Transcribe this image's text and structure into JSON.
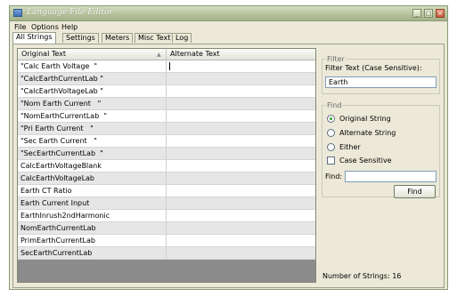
{
  "window": {
    "title": "Language File Editor",
    "controls": {
      "minimize": "_",
      "maximize": "□",
      "close": "×"
    }
  },
  "menu": [
    "File",
    "Options",
    "Help"
  ],
  "tabs": [
    {
      "label": "All Strings",
      "active": true
    },
    {
      "label": "Settings",
      "active": false
    },
    {
      "label": "Meters",
      "active": false
    },
    {
      "label": "Misc Text",
      "active": false
    },
    {
      "label": "Log",
      "active": false
    }
  ],
  "grid": {
    "columns": [
      "Original Text",
      "Alternate Text"
    ],
    "sort_indicator": "▲",
    "rows": [
      {
        "original": "\"Calc Earth Voltage  \"",
        "alternate": ""
      },
      {
        "original": "\"CalcEarthCurrentLab \"",
        "alternate": ""
      },
      {
        "original": "\"CalcEarthVoltageLab \"",
        "alternate": ""
      },
      {
        "original": "\"Nom Earth Current   \"",
        "alternate": ""
      },
      {
        "original": "\"NomEarthCurrentLab  \"",
        "alternate": ""
      },
      {
        "original": "\"Pri Earth Current   \"",
        "alternate": ""
      },
      {
        "original": "\"Sec Earth Current   \"",
        "alternate": ""
      },
      {
        "original": "\"SecEarthCurrentLab  \"",
        "alternate": ""
      },
      {
        "original": "CalcEarthVoltageBlank",
        "alternate": ""
      },
      {
        "original": "CalcEarthVoltageLab",
        "alternate": ""
      },
      {
        "original": "Earth CT Ratio",
        "alternate": ""
      },
      {
        "original": "Earth Current Input",
        "alternate": ""
      },
      {
        "original": "EarthInrush2ndHarmonic",
        "alternate": ""
      },
      {
        "original": "NomEarthCurrentLab",
        "alternate": ""
      },
      {
        "original": "PrimEarthCurrentLab",
        "alternate": ""
      },
      {
        "original": "SecEarthCurrentLab",
        "alternate": ""
      }
    ]
  },
  "filter": {
    "group_label": "Filter",
    "field_label": "Filter Text (Case Sensitive):",
    "value": "Earth"
  },
  "find": {
    "group_label": "Find",
    "options": [
      {
        "label": "Original String",
        "checked": true
      },
      {
        "label": "Alternate String",
        "checked": false
      },
      {
        "label": "Either",
        "checked": false
      }
    ],
    "case_sensitive_label": "Case Sensitive",
    "case_sensitive_checked": false,
    "find_label": "Find:",
    "find_value": "",
    "button_label": "Find"
  },
  "status": {
    "text": "Number of Strings: 16"
  }
}
